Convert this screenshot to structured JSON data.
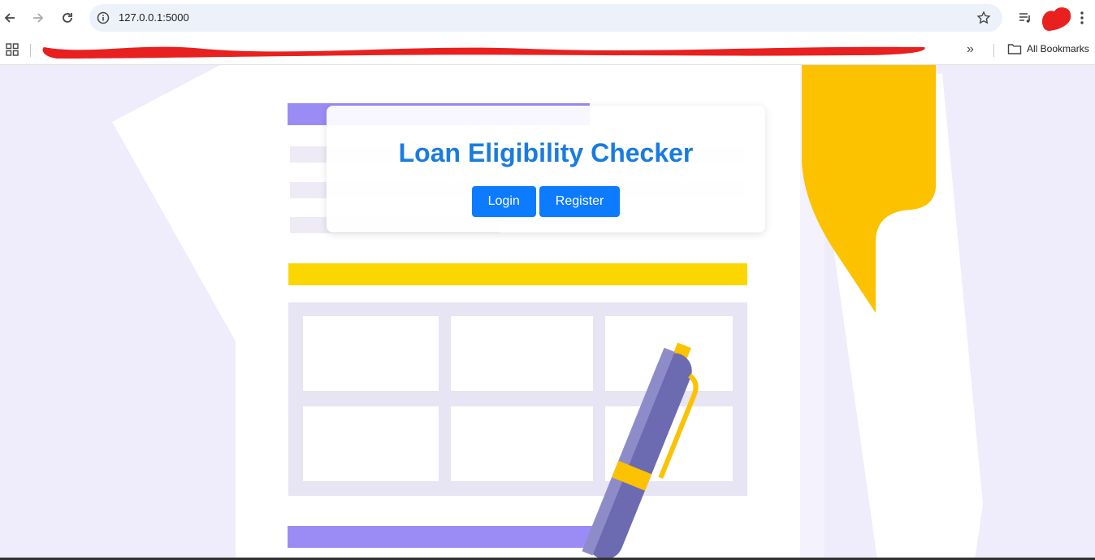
{
  "browser": {
    "url": "127.0.0.1:5000",
    "all_bookmarks_label": "All Bookmarks",
    "icons": {
      "back": "arrow-left-icon",
      "forward": "arrow-right-icon",
      "reload": "reload-icon",
      "site_info": "info-icon",
      "bookmark_star": "star-icon",
      "media": "media-queue-icon",
      "menu": "kebab-menu-icon",
      "apps": "apps-grid-icon",
      "overflow": "chevron-double-right-icon",
      "folder": "folder-icon"
    }
  },
  "page": {
    "title": "Loan Eligibility Checker",
    "login_label": "Login",
    "register_label": "Register"
  },
  "colors": {
    "title": "#1a7be0",
    "button": "#0d7bff",
    "background": "#efecfb",
    "accent_yellow": "#fcc200",
    "accent_purple": "#9b8cf5"
  }
}
